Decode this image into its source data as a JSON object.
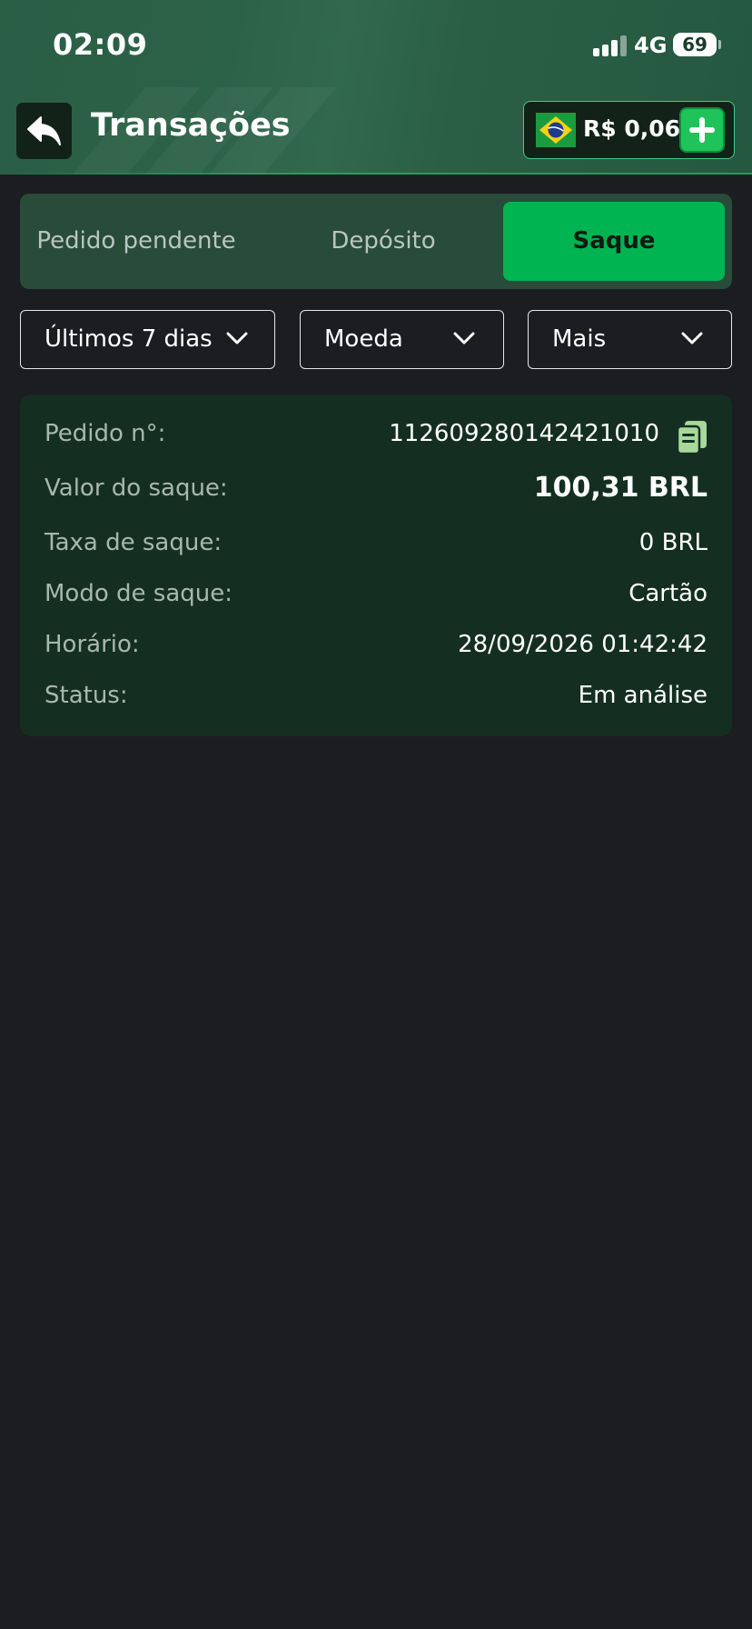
{
  "status_bar": {
    "time": "02:09",
    "network": "4G",
    "battery": "69"
  },
  "header": {
    "title": "Transações",
    "back_icon": "back-arrow-icon",
    "wallet": {
      "flag_icon": "brazil-flag-icon",
      "balance": "R$ 0,06",
      "add_icon": "plus-icon"
    }
  },
  "tabs": [
    {
      "label": "Pedido pendente",
      "active": false
    },
    {
      "label": "Depósito",
      "active": false
    },
    {
      "label": "Saque",
      "active": true
    }
  ],
  "filters": [
    {
      "label": "Últimos 7 dias"
    },
    {
      "label": "Moeda"
    },
    {
      "label": "Mais"
    }
  ],
  "transaction": {
    "order_label": "Pedido n°:",
    "order_value": "112609280142421010",
    "amount_label": "Valor do saque:",
    "amount_value": "100,31 BRL",
    "fee_label": "Taxa de saque:",
    "fee_value": "0 BRL",
    "mode_label": "Modo de saque:",
    "mode_value": "Cartão",
    "time_label": "Horário:",
    "time_value": "28/09/2026 01:42:42",
    "status_label": "Status:",
    "status_value": "Em análise"
  },
  "colors": {
    "accent": "#00b551",
    "header_green": "#2c6248",
    "card_bg": "#142f22",
    "page_bg": "#1c1d21"
  }
}
